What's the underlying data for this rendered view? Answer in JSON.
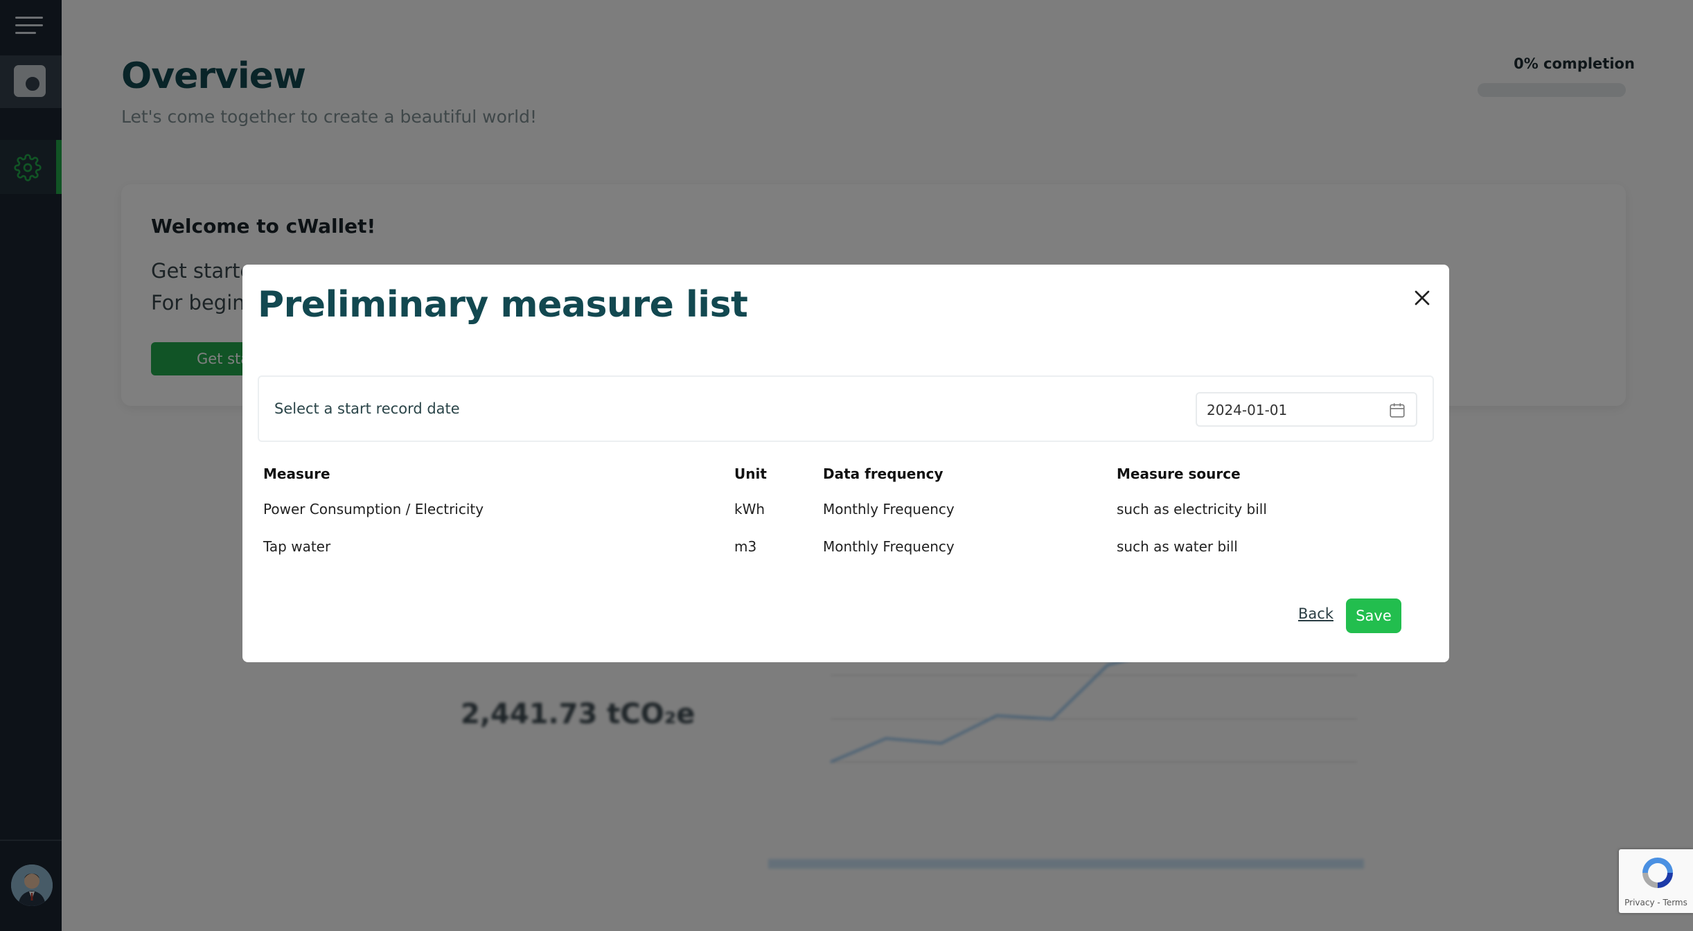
{
  "page": {
    "title": "Overview",
    "subtitle": "Let's come together to create a beautiful world!",
    "completion_label": "0% completion",
    "completion_value": 0
  },
  "welcome": {
    "title": "Welcome to cWallet!",
    "line1": "Get starte",
    "line2": "For beginn",
    "button_label": "Get sta"
  },
  "stats": {
    "total_emissions": "2,441.73 tCO₂e"
  },
  "modal": {
    "title": "Preliminary measure list",
    "date_label": "Select a start record date",
    "date_value": "2024-01-01",
    "columns": [
      "Measure",
      "Unit",
      "Data frequency",
      "Measure source"
    ],
    "rows": [
      [
        "Power Consumption / Electricity",
        "kWh",
        "Monthly Frequency",
        "such as electricity bill"
      ],
      [
        "Tap water",
        "m3",
        "Monthly Frequency",
        "such as water bill"
      ]
    ],
    "back_label": "Back",
    "save_label": "Save"
  },
  "recaptcha": {
    "text": "Privacy - Terms"
  },
  "colors": {
    "sidebar": "#1a2530",
    "accent_green": "#22be4e",
    "title_teal": "#124850"
  },
  "icons": [
    "menu-icon",
    "camera-icon",
    "gear-icon",
    "close-icon",
    "calendar-icon",
    "avatar",
    "recaptcha-logo"
  ]
}
